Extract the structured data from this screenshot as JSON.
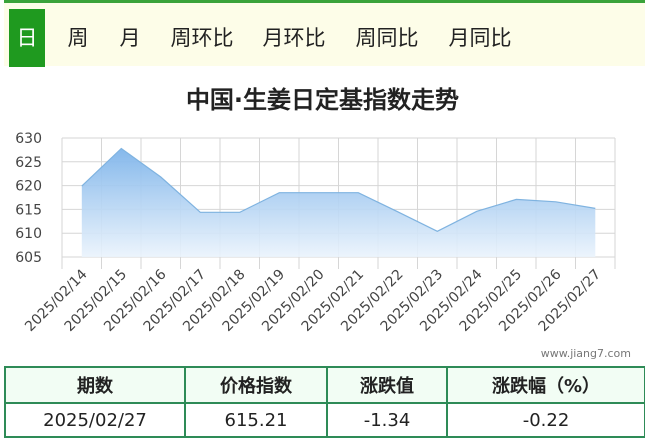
{
  "tabs": [
    {
      "label": "日",
      "active": true
    },
    {
      "label": "周",
      "active": false
    },
    {
      "label": "月",
      "active": false
    },
    {
      "label": "周环比",
      "active": false
    },
    {
      "label": "月环比",
      "active": false
    },
    {
      "label": "周同比",
      "active": false
    },
    {
      "label": "月同比",
      "active": false
    }
  ],
  "watermark": "www.jiang7.com",
  "colors": {
    "line": "#7fb3e0",
    "fill_top": "#7eb4ea",
    "grid": "#d6d6d6",
    "accent": "#1f9a1f"
  },
  "chart_data": {
    "type": "area",
    "title": "中国·生姜日定基指数走势",
    "categories": [
      "2025/02/14",
      "2025/02/15",
      "2025/02/16",
      "2025/02/17",
      "2025/02/18",
      "2025/02/19",
      "2025/02/20",
      "2025/02/21",
      "2025/02/22",
      "2025/02/23",
      "2025/02/24",
      "2025/02/25",
      "2025/02/26",
      "2025/02/27"
    ],
    "values": [
      619.9,
      627.8,
      621.8,
      614.4,
      614.4,
      618.5,
      618.5,
      618.5,
      614.5,
      610.4,
      614.6,
      617.1,
      616.6,
      615.2
    ],
    "yticks": [
      605,
      610,
      615,
      620,
      625,
      630
    ],
    "ylim": [
      605,
      630
    ],
    "grid": true,
    "legend": "none"
  },
  "summary": {
    "headers": [
      "期数",
      "价格指数",
      "涨跌值",
      "涨跌幅（%）"
    ],
    "row": [
      "2025/02/27",
      "615.21",
      "-1.34",
      "-0.22"
    ]
  }
}
